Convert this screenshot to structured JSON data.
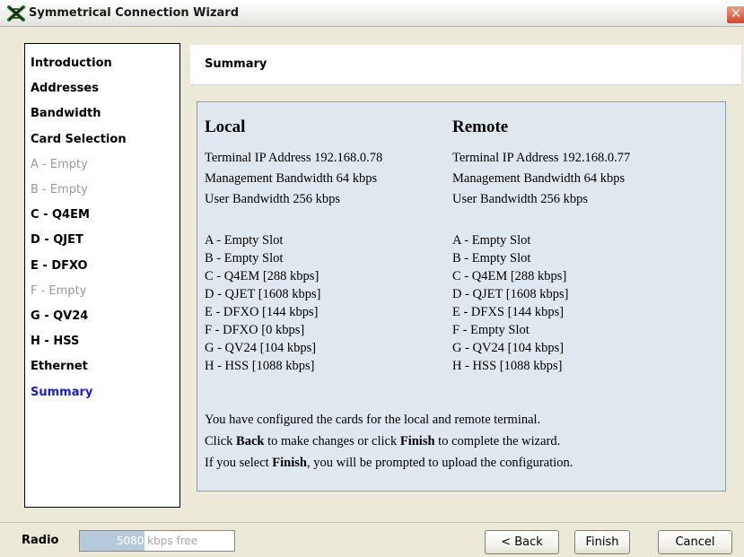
{
  "window": {
    "title": "Symmetrical Connection Wizard",
    "close_glyph": "✕"
  },
  "nav": {
    "items": [
      {
        "label": "Introduction",
        "state": "done"
      },
      {
        "label": "Addresses",
        "state": "done"
      },
      {
        "label": "Bandwidth",
        "state": "done"
      },
      {
        "label": "Card Selection",
        "state": "done"
      },
      {
        "label": "A - Empty",
        "state": "disabled"
      },
      {
        "label": "B - Empty",
        "state": "disabled"
      },
      {
        "label": "C - Q4EM",
        "state": "done"
      },
      {
        "label": "D - QJET",
        "state": "done"
      },
      {
        "label": "E - DFXO",
        "state": "done"
      },
      {
        "label": "F - Empty",
        "state": "disabled"
      },
      {
        "label": "G - QV24",
        "state": "done"
      },
      {
        "label": "H - HSS",
        "state": "done"
      },
      {
        "label": "Ethernet",
        "state": "done"
      },
      {
        "label": "Summary",
        "state": "active"
      }
    ]
  },
  "summary": {
    "title": "Summary",
    "local": {
      "heading": "Local",
      "ip": "Terminal IP Address 192.168.0.78",
      "mgmt_bw": "Management Bandwidth 64 kbps",
      "user_bw": "User Bandwidth 256 kbps",
      "slots": [
        "A - Empty Slot",
        "B - Empty Slot",
        "C - Q4EM [288 kbps]",
        "D - QJET [1608 kbps]",
        "E - DFXO [144 kbps]",
        "F - DFXO [0 kbps]",
        "G - QV24 [104 kbps]",
        "H - HSS [1088 kbps]"
      ]
    },
    "remote": {
      "heading": "Remote",
      "ip": "Terminal IP Address 192.168.0.77",
      "mgmt_bw": "Management Bandwidth 64 kbps",
      "user_bw": "User Bandwidth 256 kbps",
      "slots": [
        "A - Empty Slot",
        "B - Empty Slot",
        "C - Q4EM [288 kbps]",
        "D - QJET [1608 kbps]",
        "E - DFXS [144 kbps]",
        "F - Empty Slot",
        "G - QV24 [104 kbps]",
        "H - HSS [1088 kbps]"
      ]
    },
    "message": {
      "line1": "You have configured the cards for the local and remote terminal.",
      "line2_a": "Click ",
      "line2_back": "Back",
      "line2_b": " to make changes or click ",
      "line2_finish": "Finish",
      "line2_c": " to complete the wizard.",
      "line3_a": "If you select ",
      "line3_finish": "Finish",
      "line3_b": ", you will be prompted to upload the configuration."
    }
  },
  "footer": {
    "radio_label": "Radio",
    "bandwidth_value": "5080",
    "bandwidth_unit": "kbps free",
    "bandwidth_fill_fraction": 0.42,
    "back_label": "< Back",
    "finish_label": "Finish",
    "cancel_label": "Cancel"
  },
  "colors": {
    "active_nav": "#1a1ad0",
    "disabled_nav": "#9a9a9a",
    "content_bg": "#dfe8ee",
    "window_bg": "#ece9d8"
  },
  "icons": {
    "app": "network-x-icon",
    "close": "close-icon"
  }
}
